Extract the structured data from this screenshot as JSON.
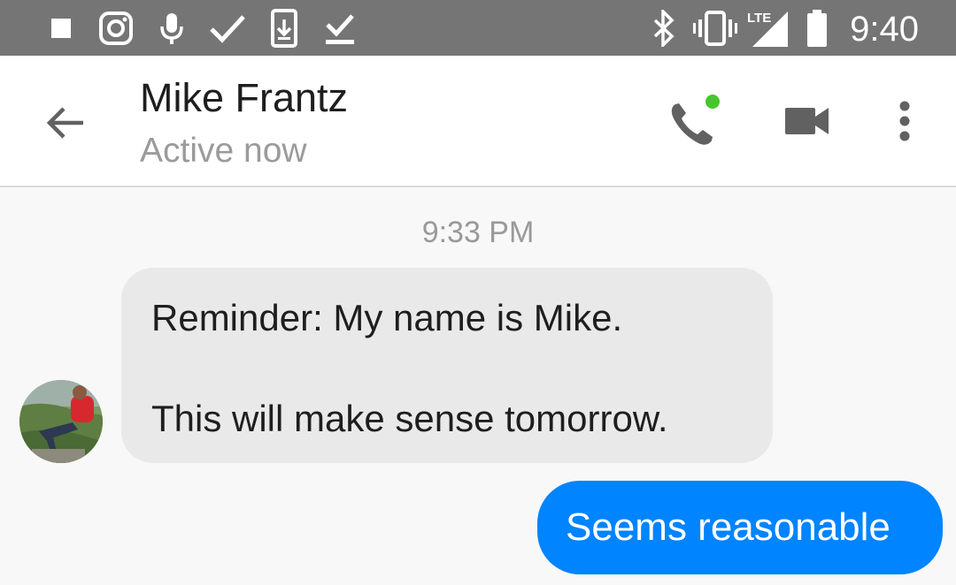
{
  "status_bar": {
    "time": "9:40",
    "network_label": "LTE",
    "icons": [
      "square-notification-icon",
      "instagram-icon",
      "microphone-icon",
      "check-icon",
      "download-icon",
      "download-done-icon",
      "bluetooth-icon",
      "vibrate-icon",
      "lte-signal-icon",
      "battery-icon"
    ]
  },
  "header": {
    "contact_name": "Mike Frantz",
    "status": "Active now",
    "active_dot_color": "#44c72c"
  },
  "thread": {
    "timestamp": "9:33 PM",
    "incoming": {
      "line1": "Reminder: My name is Mike.",
      "line2": "This will make sense tomorrow."
    },
    "outgoing": {
      "text": "Seems reasonable"
    }
  },
  "colors": {
    "status_bar": "#757575",
    "outgoing_bubble": "#0084ff",
    "incoming_bubble": "#e9e9e9",
    "icon_gray": "#616161"
  }
}
